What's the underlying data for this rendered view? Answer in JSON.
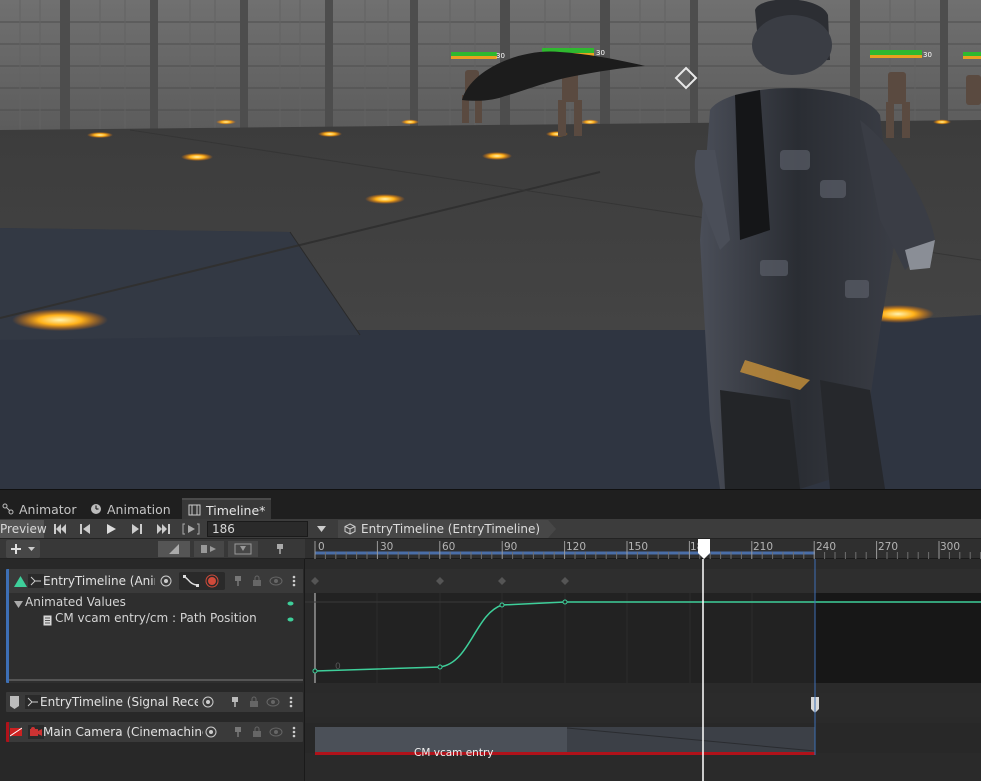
{
  "editor": {
    "tabs": [
      {
        "label": "Animator",
        "icon": "animator-icon"
      },
      {
        "label": "Animation",
        "icon": "clock-icon"
      },
      {
        "label": "Timeline*",
        "icon": "filmstrip-icon"
      }
    ],
    "toolbar": {
      "preview_label": "Preview",
      "current_frame": "186",
      "breadcrumb": "EntryTimeline (EntryTimeline)"
    },
    "ruler": {
      "frames": [
        "0",
        "30",
        "60",
        "90",
        "120",
        "150",
        "180",
        "210",
        "240",
        "270",
        "300"
      ]
    },
    "tracks": [
      {
        "name": "EntryTimeline (Anim",
        "type": "animation-track"
      },
      {
        "name": "EntryTimeline (Signal Receiv",
        "type": "signal-track"
      },
      {
        "name": "Main Camera (Cinemachine",
        "type": "cinemachine-track"
      }
    ],
    "animated_values": {
      "group_label": "Animated Values",
      "property_label": "CM vcam entry/cm : Path Position"
    },
    "clip": {
      "label": "CM vcam entry"
    },
    "hud": {
      "health_value": "30"
    },
    "colors": {
      "accent_curve": "#3ecf9a",
      "track_blue": "#3d6fb5",
      "record_red": "#d04a3a",
      "clip_red": "#b0121a",
      "playhead": "#ffffff"
    }
  }
}
